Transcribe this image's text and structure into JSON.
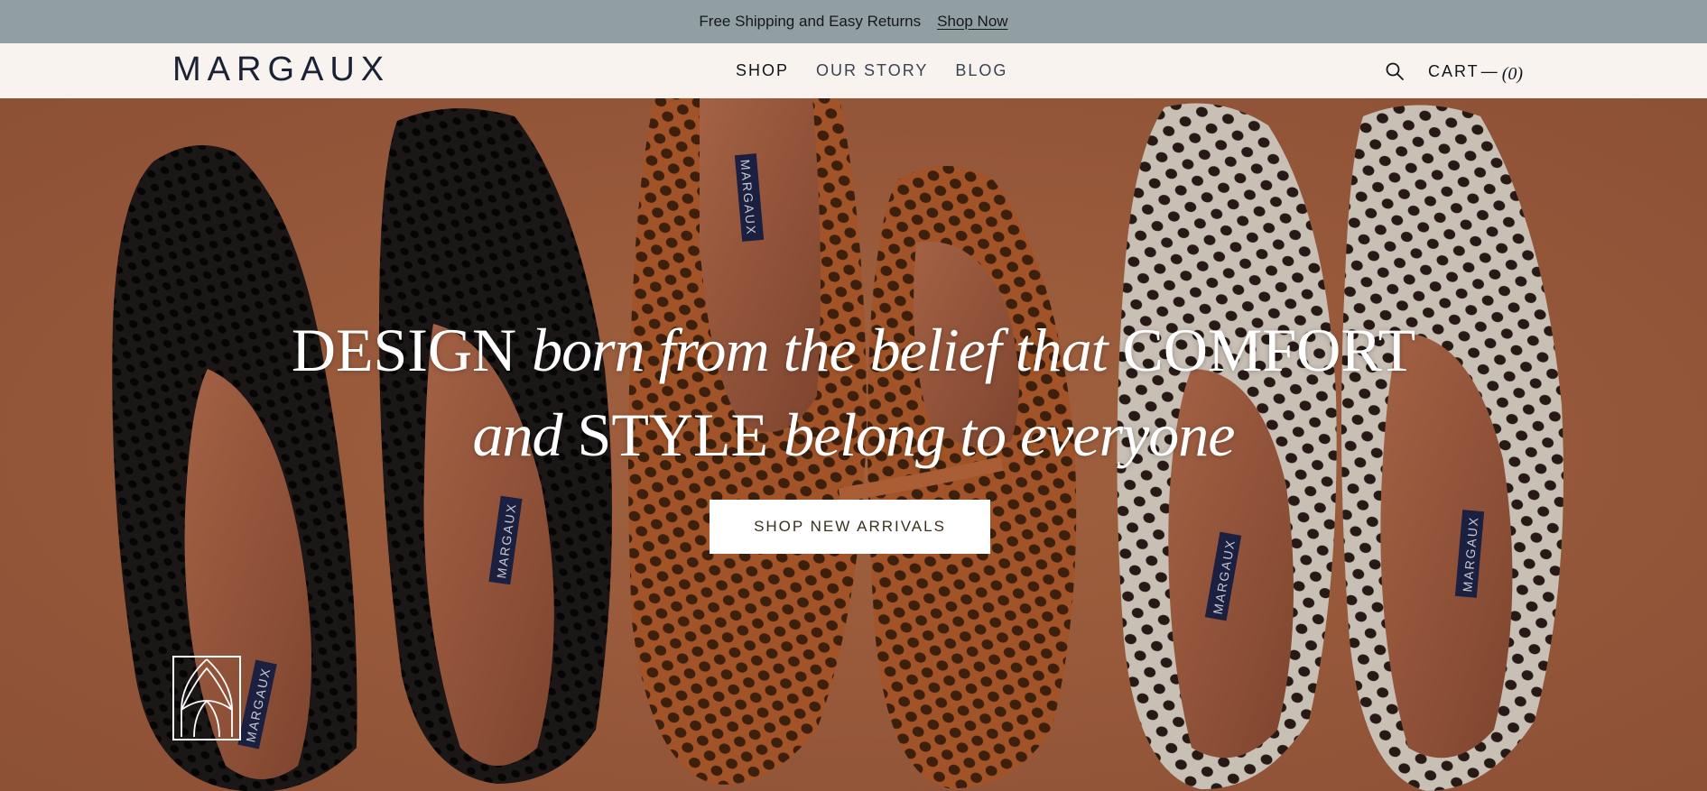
{
  "announcement": {
    "message": "Free Shipping and Easy Returns",
    "link": "Shop Now"
  },
  "header": {
    "logo": "MARGAUX",
    "nav": [
      {
        "label": "SHOP",
        "active": true
      },
      {
        "label": "OUR STORY",
        "active": false
      },
      {
        "label": "BLOG",
        "active": false
      }
    ],
    "search_icon": "search-icon",
    "cart": {
      "label": "CART",
      "separator": "—",
      "count": "(0)"
    }
  },
  "hero": {
    "headline": {
      "w1": "DESIGN",
      "w2": "born from the belief that",
      "w3": "COMFORT",
      "w4": "and",
      "w5": "STYLE",
      "w6": "belong to everyone"
    },
    "cta_label": "SHOP NEW ARRIVALS",
    "insole_label": "MARGAUX",
    "monogram_icon": "margaux-monogram-icon"
  },
  "colors": {
    "announcement_bg": "#919fa2",
    "header_bg": "#f8f3ee",
    "brand_text": "#1b2236",
    "hero_bg": "#a8613d"
  }
}
